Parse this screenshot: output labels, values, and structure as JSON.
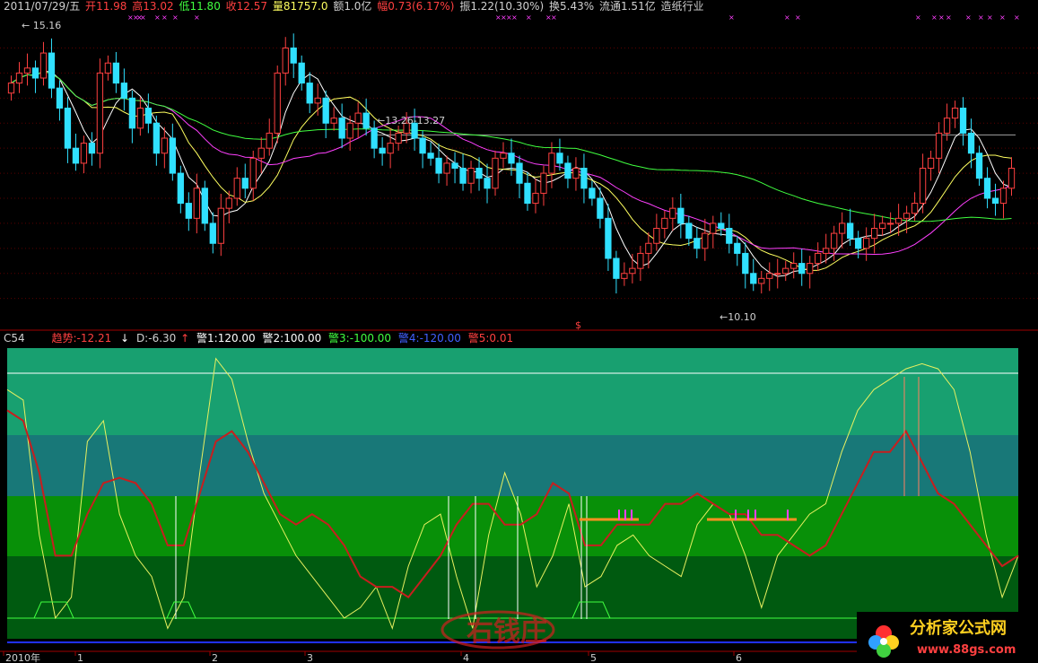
{
  "header": {
    "date": "2011/07/29/五",
    "open_label": "开",
    "open": "11.98",
    "high_label": "高",
    "high": "13.02",
    "low_label": "低",
    "low": "11.80",
    "close_label": "收",
    "close": "12.57",
    "volume_label": "量",
    "volume": "81757.0",
    "amount_label": "额",
    "amount": "1.0亿",
    "change_label": "幅",
    "change": "0.73(6.17%)",
    "amplitude_label": "振",
    "amplitude": "1.22(10.30%)",
    "turnover_label": "换",
    "turnover": "5.43%",
    "float_label": "流通",
    "float": "1.51亿",
    "industry": "造纸行业"
  },
  "indicator_header": {
    "name": "C54",
    "trend_label": "趋势:",
    "trend": "-12.21",
    "d_label": "D:",
    "d": "-6.30",
    "alert1_label": "警1:",
    "alert1": "120.00",
    "alert2_label": "警2:",
    "alert2": "100.00",
    "alert3_label": "警3:",
    "alert3": "-100.00",
    "alert4_label": "警4:",
    "alert4": "-120.00",
    "alert5_label": "警5:",
    "alert5": "0.01"
  },
  "annotations": {
    "high_marker": "15.16",
    "mid_marker": "13.26-13.27",
    "low_marker": "10.10",
    "dollar": "$"
  },
  "x_axis": {
    "labels": [
      "2010年",
      "1",
      "2",
      "3",
      "4",
      "5",
      "6"
    ]
  },
  "watermarks": {
    "left": "右钱庄",
    "right_title": "分析家公式网",
    "right_url": "www.88gs.com"
  },
  "colors": {
    "up": "#ff4040",
    "down": "#30e0ff",
    "ma5": "#ffffff",
    "ma10": "#ffff60",
    "ma20": "#ff40ff",
    "ma60": "#40ff40",
    "trend_line": "#c81e1e",
    "d_line": "#e8f060",
    "band_top": "#18a070",
    "band_mid": "#187878",
    "band_green": "#089008",
    "band_dark": "#005a10"
  },
  "chart_data": [
    {
      "type": "candlestick",
      "title": "",
      "ylim": [
        9.6,
        15.6
      ],
      "overlays": [
        "MA5",
        "MA10",
        "MA20",
        "MA60"
      ],
      "candles_close": [
        14.3,
        14.5,
        14.6,
        14.4,
        14.9,
        14.2,
        13.8,
        13.0,
        12.7,
        13.1,
        12.9,
        14.5,
        14.7,
        14.3,
        14.0,
        13.4,
        13.8,
        13.5,
        12.9,
        13.2,
        12.5,
        11.9,
        11.6,
        12.2,
        11.5,
        11.1,
        11.8,
        12.0,
        12.4,
        12.2,
        12.8,
        13.0,
        13.3,
        14.5,
        15.0,
        14.7,
        14.3,
        13.9,
        14.0,
        13.5,
        13.6,
        13.2,
        13.5,
        13.7,
        13.4,
        13.0,
        12.9,
        13.1,
        13.3,
        13.5,
        13.2,
        12.9,
        12.8,
        12.5,
        12.7,
        12.6,
        12.3,
        12.6,
        12.4,
        12.2,
        12.8,
        12.9,
        12.7,
        12.3,
        11.9,
        12.1,
        12.5,
        12.9,
        12.7,
        12.4,
        12.6,
        12.2,
        12.0,
        11.6,
        10.8,
        10.4,
        10.5,
        10.6,
        10.9,
        11.1,
        11.4,
        11.6,
        11.8,
        11.5,
        11.2,
        11.0,
        11.3,
        11.5,
        11.4,
        11.1,
        10.9,
        10.5,
        10.3,
        10.4,
        10.5,
        10.5,
        10.6,
        10.7,
        10.5,
        10.7,
        10.9,
        11.0,
        11.3,
        11.5,
        11.2,
        11.0,
        11.2,
        11.4,
        11.5,
        11.5,
        11.6,
        11.7,
        11.9,
        12.6,
        12.8,
        13.3,
        13.6,
        13.8,
        13.3,
        12.9,
        12.4,
        12.0,
        11.9,
        12.2,
        12.6
      ],
      "ma_legend": [
        "MA5",
        "MA10",
        "MA20",
        "MA60"
      ]
    },
    {
      "type": "line",
      "title": "",
      "ylim": [
        -140,
        140
      ],
      "series": [
        {
          "name": "趋势",
          "values": [
            80,
            70,
            20,
            -60,
            -60,
            -20,
            10,
            15,
            10,
            -10,
            -50,
            -50,
            0,
            50,
            60,
            40,
            10,
            -20,
            -30,
            -20,
            -30,
            -50,
            -80,
            -90,
            -90,
            -100,
            -80,
            -60,
            -30,
            -10,
            -10,
            -30,
            -30,
            -20,
            10,
            0,
            -50,
            -50,
            -30,
            -30,
            -30,
            -10,
            -10,
            0,
            -10,
            -20,
            -20,
            -40,
            -40,
            -50,
            -60,
            -50,
            -20,
            10,
            40,
            40,
            60,
            30,
            0,
            -10,
            -30,
            -50,
            -70,
            -60
          ]
        },
        {
          "name": "D",
          "values": [
            100,
            90,
            -40,
            -120,
            -100,
            50,
            70,
            -20,
            -60,
            -80,
            -130,
            -100,
            20,
            130,
            110,
            50,
            0,
            -30,
            -60,
            -80,
            -100,
            -120,
            -110,
            -90,
            -130,
            -70,
            -30,
            -20,
            -80,
            -130,
            -40,
            20,
            -20,
            -90,
            -60,
            -10,
            -90,
            -80,
            -50,
            -40,
            -60,
            -70,
            -80,
            -30,
            -10,
            -20,
            -60,
            -110,
            -60,
            -40,
            -20,
            -10,
            40,
            80,
            100,
            110,
            120,
            125,
            120,
            100,
            40,
            -40,
            -100,
            -60
          ]
        }
      ],
      "bands": [
        120,
        100,
        -100,
        -120
      ]
    }
  ]
}
